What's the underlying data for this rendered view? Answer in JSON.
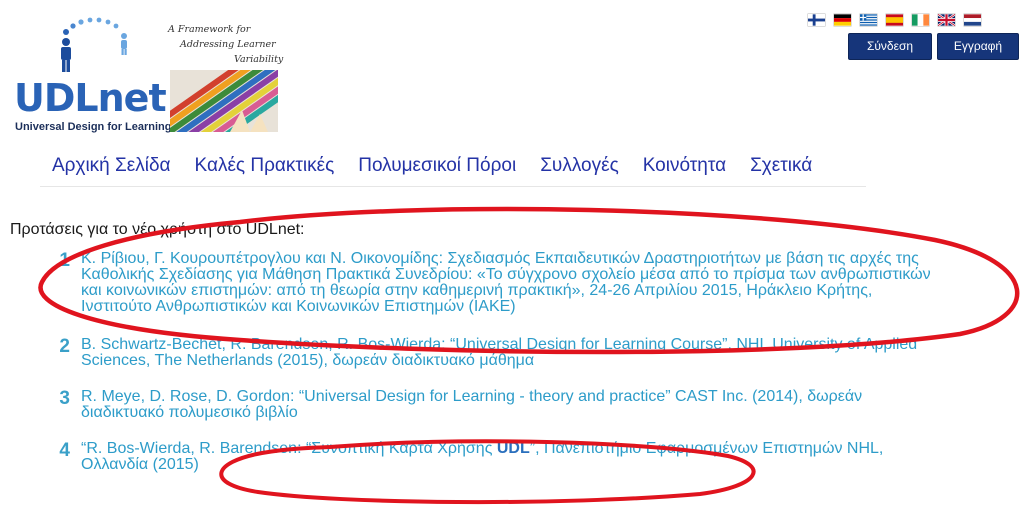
{
  "logo": {
    "name": "UDLnet",
    "subtitle": "Universal Design for Learning",
    "tagline_1": "A Framework for",
    "tagline_2": "Addressing Learner",
    "tagline_3": "Variability"
  },
  "languages": [
    "finnish-flag",
    "german-flag",
    "greek-flag",
    "spanish-flag",
    "irish-flag",
    "english-flag",
    "dutch-flag"
  ],
  "auth": {
    "login": "Σύνδεση",
    "signup": "Εγγραφή"
  },
  "nav": {
    "home": "Αρχική Σελίδα",
    "good_practices": "Καλές Πρακτικές",
    "multimedia": "Πολυμεσικοί Πόροι",
    "collections": "Συλλογές",
    "community": "Κοινότητα",
    "about": "Σχετικά"
  },
  "content": {
    "title": "Προτάσεις για το νέο χρήστη στο UDLnet:",
    "refs": [
      {
        "num": "1",
        "lines": [
          "Κ. Ρίβιου, Γ. Κουρουπέτρογλου και Ν. Οικονομίδης: Σχεδιασμός Εκπαιδευτικών Δραστηριοτήτων με βάση τις αρχές της",
          "Καθολικής Σχεδίασης για Μάθηση Πρακτικά Συνεδρίου: «Το σύγχρονο σχολείο μέσα από το πρίσμα των ανθρωπιστικών",
          "και κοινωνικών επιστημών: από τη θεωρία στην καθημερινή πρακτική», 24-26 Απριλίου 2015, Ηράκλειο Κρήτης,",
          "Ινστιτούτο Ανθρωπιστικών και Κοινωνικών Επιστημών (ΙΑΚΕ)"
        ]
      },
      {
        "num": "2",
        "lines": [
          "B. Schwartz-Bechet, R. Barendsen, R. Bos-Wierda: “Universal Design for Learning Course”, NHL University of Applied",
          "Sciences, The Netherlands (2015), δωρεάν διαδικτυακό μάθημα"
        ]
      },
      {
        "num": "3",
        "lines": [
          "R. Meye, D. Rose, D. Gordon: “Universal Design for Learning - theory and practice” CAST Inc. (2014), δωρεάν",
          "διαδικτυακό πολυμεσικό βιβλίο"
        ]
      },
      {
        "num": "4",
        "line1_pre": "“R. Bos-Wierda, R. Barendsen: “Συνοπτική Κάρτα Χρήσης ",
        "line1_bold": "UDL",
        "line1_post": "”, Πανεπιστήμιο Εφαρμοσμένων Επιστημών NHL,",
        "line2": "Ολλανδία (2015)"
      }
    ]
  },
  "colors": {
    "link": "#2d9cc9",
    "nav": "#2433a6",
    "button": "#16357a",
    "annotation": "#e0141e"
  }
}
